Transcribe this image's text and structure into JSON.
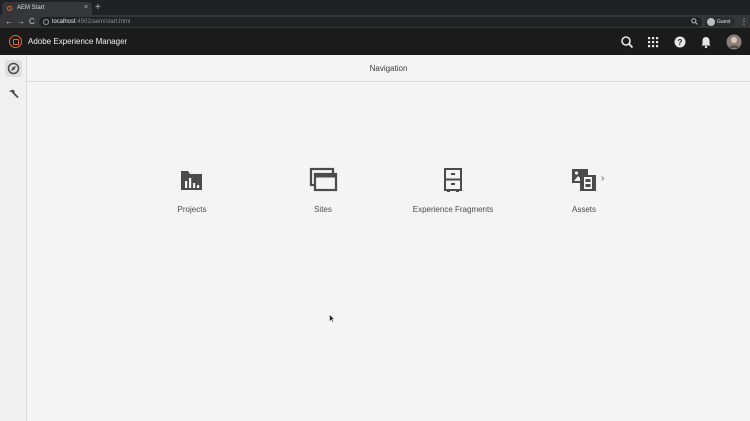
{
  "browser": {
    "tab_title": "AEM Start",
    "tab_close": "×",
    "new_tab": "+",
    "back": "←",
    "forward": "→",
    "reload": "C",
    "url_host": "localhost",
    "url_rest": ":4502/aem/start.html",
    "zoom_icon": "search-icon",
    "profile_label": "Guest",
    "menu": "⋮"
  },
  "aem": {
    "title": "Adobe Experience Manager",
    "header_icons": [
      "search-icon",
      "apps-grid-icon",
      "help-icon",
      "bell-icon",
      "user-avatar"
    ]
  },
  "rail": {
    "items": [
      {
        "icon": "compass-icon",
        "selected": true
      },
      {
        "icon": "hammer-icon",
        "selected": false
      }
    ]
  },
  "navigation": {
    "title": "Navigation"
  },
  "tiles": [
    {
      "label": "Projects",
      "icon": "projects-folder-icon"
    },
    {
      "label": "Sites",
      "icon": "sites-windows-icon"
    },
    {
      "label": "Experience Fragments",
      "icon": "cabinet-icon"
    },
    {
      "label": "Assets",
      "icon": "assets-media-icon",
      "chevron": "›"
    }
  ],
  "colors": {
    "accent": "#e46b2e",
    "header_bg": "#1b1b1b",
    "page_bg": "#f4f4f4",
    "icon": "#4b4b4b"
  }
}
